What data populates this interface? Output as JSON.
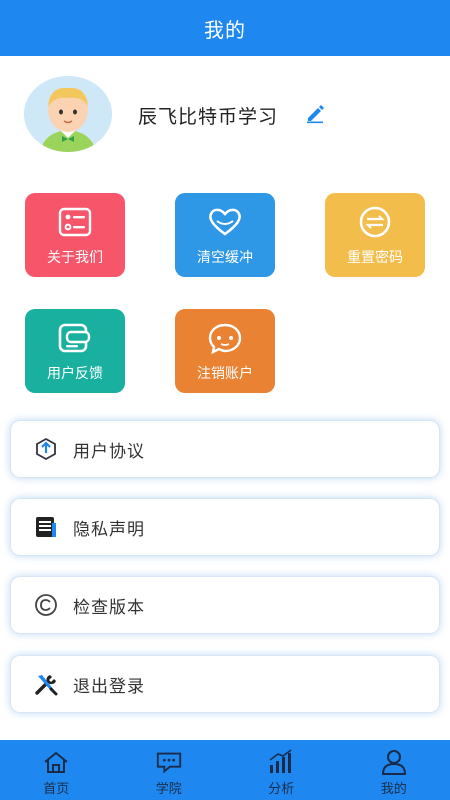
{
  "header": {
    "title": "我的"
  },
  "profile": {
    "username": "辰飞比特币学习",
    "avatar": "cartoon-boy-avatar",
    "edit_icon": "pencil-icon"
  },
  "tiles": [
    {
      "label": "关于我们",
      "icon": "checklist-icon",
      "color": "#f7566a"
    },
    {
      "label": "清空缓冲",
      "icon": "heart-icon",
      "color": "#2e97e6"
    },
    {
      "label": "重置密码",
      "icon": "swap-arrows-icon",
      "color": "#f2bd4b"
    },
    {
      "label": "用户反馈",
      "icon": "feedback-icon",
      "color": "#19b0a0"
    },
    {
      "label": "注销账户",
      "icon": "chat-face-icon",
      "color": "#ea8233"
    }
  ],
  "list": [
    {
      "label": "用户协议",
      "icon": "upload-hexagon-icon"
    },
    {
      "label": "隐私声明",
      "icon": "document-icon"
    },
    {
      "label": "检查版本",
      "icon": "copyright-icon"
    },
    {
      "label": "退出登录",
      "icon": "tools-icon"
    }
  ],
  "tabbar": {
    "items": [
      {
        "label": "首页",
        "icon": "home-icon"
      },
      {
        "label": "学院",
        "icon": "message-icon"
      },
      {
        "label": "分析",
        "icon": "bar-chart-icon"
      },
      {
        "label": "我的",
        "icon": "user-icon"
      }
    ],
    "active_index": 3
  },
  "colors": {
    "primary": "#1e88f0",
    "tab_label": "#1a2b48"
  }
}
